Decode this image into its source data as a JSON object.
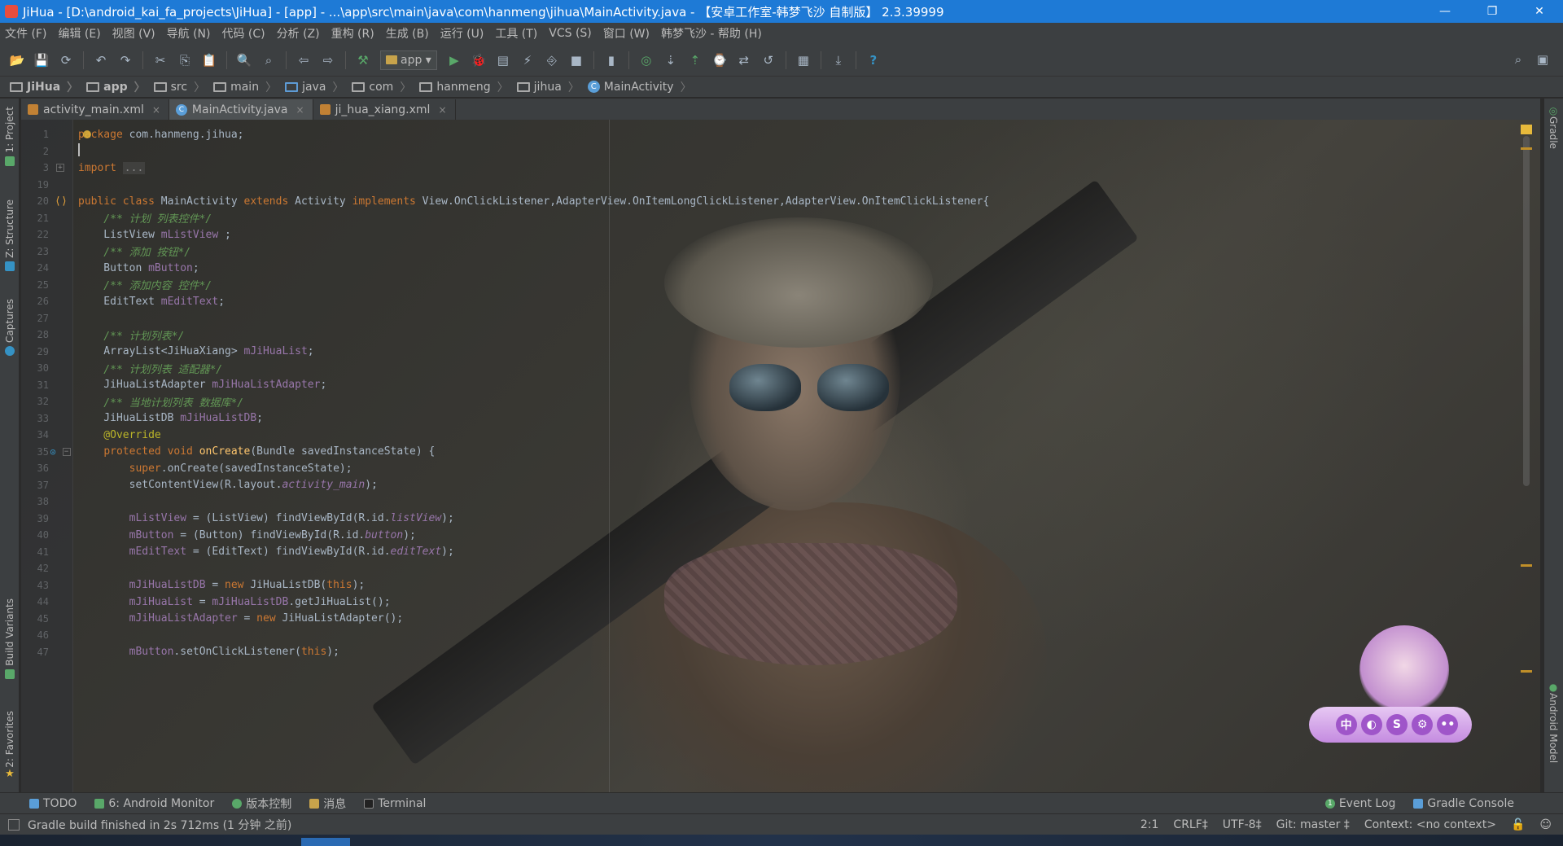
{
  "window": {
    "title": "JiHua - [D:\\android_kai_fa_projects\\JiHua] - [app] - ...\\app\\src\\main\\java\\com\\hanmeng\\jihua\\MainActivity.java - 【安卓工作室-韩梦飞沙 自制版】 2.3.39999",
    "minimize": "—",
    "restore": "❐",
    "close": "✕"
  },
  "menu": [
    "文件 (F)",
    "编辑 (E)",
    "视图 (V)",
    "导航 (N)",
    "代码 (C)",
    "分析 (Z)",
    "重构 (R)",
    "生成 (B)",
    "运行 (U)",
    "工具 (T)",
    "VCS (S)",
    "窗口 (W)",
    "韩梦飞沙 - 帮助 (H)"
  ],
  "toolbar": {
    "run_config": "app",
    "icons": [
      "open-icon",
      "save-icon",
      "sync-icon",
      "undo-icon",
      "redo-icon",
      "cut-icon",
      "copy-icon",
      "paste-icon",
      "find-icon",
      "replace-icon",
      "back-icon",
      "forward-icon",
      "make-icon",
      "run-icon",
      "debug-icon",
      "coverage-icon",
      "apply-changes-icon",
      "attach-debugger-icon",
      "stop-icon",
      "avd-manager-icon",
      "sdk-manager-icon",
      "vcs-update-icon",
      "vcs-commit-icon",
      "vcs-history-icon",
      "vcs-compare-icon",
      "vcs-revert-icon",
      "project-structure-icon",
      "download-icon",
      "help-icon"
    ],
    "help": "?"
  },
  "breadcrumb": [
    "JiHua",
    "app",
    "src",
    "main",
    "java",
    "com",
    "hanmeng",
    "jihua",
    "MainActivity"
  ],
  "tabs": [
    {
      "label": "activity_main.xml",
      "close": "×"
    },
    {
      "label": "MainActivity.java",
      "close": "×"
    },
    {
      "label": "ji_hua_xiang.xml",
      "close": "×"
    }
  ],
  "left_tools": {
    "project": "1: Project",
    "structure": "Z: Structure",
    "captures": "Captures",
    "build_variants": "Build Variants",
    "favorites": "2: Favorites"
  },
  "right_tools": {
    "gradle": "Gradle",
    "android_model": "Android Model"
  },
  "code_lines": [
    {
      "n": "1",
      "text": "package com.hanmeng.jihua;"
    },
    {
      "n": "2",
      "text": ""
    },
    {
      "n": "3",
      "text": "import ..."
    },
    {
      "n": "19",
      "text": ""
    },
    {
      "n": "20",
      "text": "public class MainActivity extends Activity implements View.OnClickListener,AdapterView.OnItemLongClickListener,AdapterView.OnItemClickListener{"
    },
    {
      "n": "21",
      "text": "    /** 计划 列表控件*/"
    },
    {
      "n": "22",
      "text": "    ListView mListView ;"
    },
    {
      "n": "23",
      "text": "    /** 添加 按钮*/"
    },
    {
      "n": "24",
      "text": "    Button mButton;"
    },
    {
      "n": "25",
      "text": "    /** 添加内容 控件*/"
    },
    {
      "n": "26",
      "text": "    EditText mEditText;"
    },
    {
      "n": "27",
      "text": ""
    },
    {
      "n": "28",
      "text": "    /** 计划列表*/"
    },
    {
      "n": "29",
      "text": "    ArrayList<JiHuaXiang> mJiHuaList;"
    },
    {
      "n": "30",
      "text": "    /** 计划列表 适配器*/"
    },
    {
      "n": "31",
      "text": "    JiHuaListAdapter mJiHuaListAdapter;"
    },
    {
      "n": "32",
      "text": "    /** 当地计划列表 数据库*/"
    },
    {
      "n": "33",
      "text": "    JiHuaListDB mJiHuaListDB;"
    },
    {
      "n": "34",
      "text": "    @Override"
    },
    {
      "n": "35",
      "text": "    protected void onCreate(Bundle savedInstanceState) {"
    },
    {
      "n": "36",
      "text": "        super.onCreate(savedInstanceState);"
    },
    {
      "n": "37",
      "text": "        setContentView(R.layout.activity_main);"
    },
    {
      "n": "38",
      "text": ""
    },
    {
      "n": "39",
      "text": "        mListView = (ListView) findViewById(R.id.listView);"
    },
    {
      "n": "40",
      "text": "        mButton = (Button) findViewById(R.id.button);"
    },
    {
      "n": "41",
      "text": "        mEditText = (EditText) findViewById(R.id.editText);"
    },
    {
      "n": "42",
      "text": ""
    },
    {
      "n": "43",
      "text": "        mJiHuaListDB = new JiHuaListDB(this);"
    },
    {
      "n": "44",
      "text": "        mJiHuaList = mJiHuaListDB.getJiHuaList();"
    },
    {
      "n": "45",
      "text": "        mJiHuaListAdapter = new JiHuaListAdapter();"
    },
    {
      "n": "46",
      "text": ""
    },
    {
      "n": "47",
      "text": "        mButton.setOnClickListener(this);"
    }
  ],
  "widget_buttons": [
    "中",
    "◐",
    "S",
    "⚙",
    "••"
  ],
  "bottom_tools": [
    {
      "label": "TODO"
    },
    {
      "label": "6: Android Monitor"
    },
    {
      "label": "版本控制"
    },
    {
      "label": "消息"
    },
    {
      "label": "Terminal"
    }
  ],
  "bottom_right_tools": [
    {
      "label": "Event Log",
      "badge": "1"
    },
    {
      "label": "Gradle Console"
    }
  ],
  "status": {
    "message": "Gradle build finished in 2s 712ms (1 分钟 之前)",
    "position": "2:1",
    "line_sep": "CRLF‡",
    "encoding": "UTF-8‡",
    "git": "Git: master ‡",
    "context": "Context: <no context>"
  },
  "colors": {
    "titlebar": "#1e7ad6",
    "keyword": "#cc7832",
    "comment": "#629755",
    "field": "#9876aa",
    "method": "#ffc66d",
    "annotation": "#bbb529"
  }
}
